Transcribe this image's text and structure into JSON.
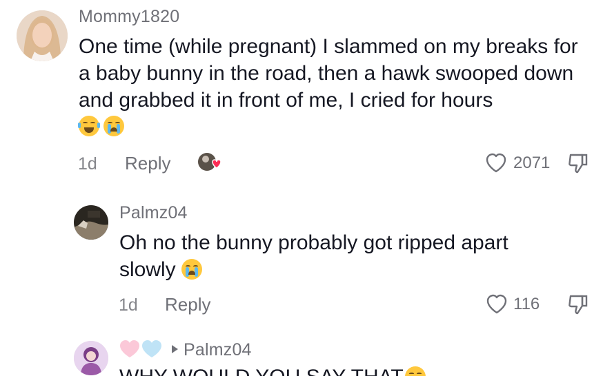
{
  "comments": [
    {
      "username": "Mommy1820",
      "text": "One time (while pregnant) I slammed on my breaks for a baby bunny in the road, then a hawk swooped down and grabbed it in front of me, I cried for hours",
      "emojis": [
        "laughing-crying-emoji",
        "loudly-crying-emoji"
      ],
      "age": "1d",
      "reply_label": "Reply",
      "likes": "2071",
      "liked_by_creator": true
    },
    {
      "username": "Palmz04",
      "text_line1": "Oh no the bunny probably got ripped apart",
      "text_line2": "slowly",
      "emojis": [
        "loudly-crying-emoji"
      ],
      "age": "1d",
      "reply_label": "Reply",
      "likes": "116"
    },
    {
      "username_hearts": [
        "pink-heart",
        "light-blue-heart"
      ],
      "reply_to": "Palmz04",
      "text": "WHY WOULD YOU SAY THAT"
    }
  ],
  "colors": {
    "text": "#161823",
    "secondary": "#6f7077",
    "background": "#ffffff",
    "heart_red": "#fe2c55"
  }
}
